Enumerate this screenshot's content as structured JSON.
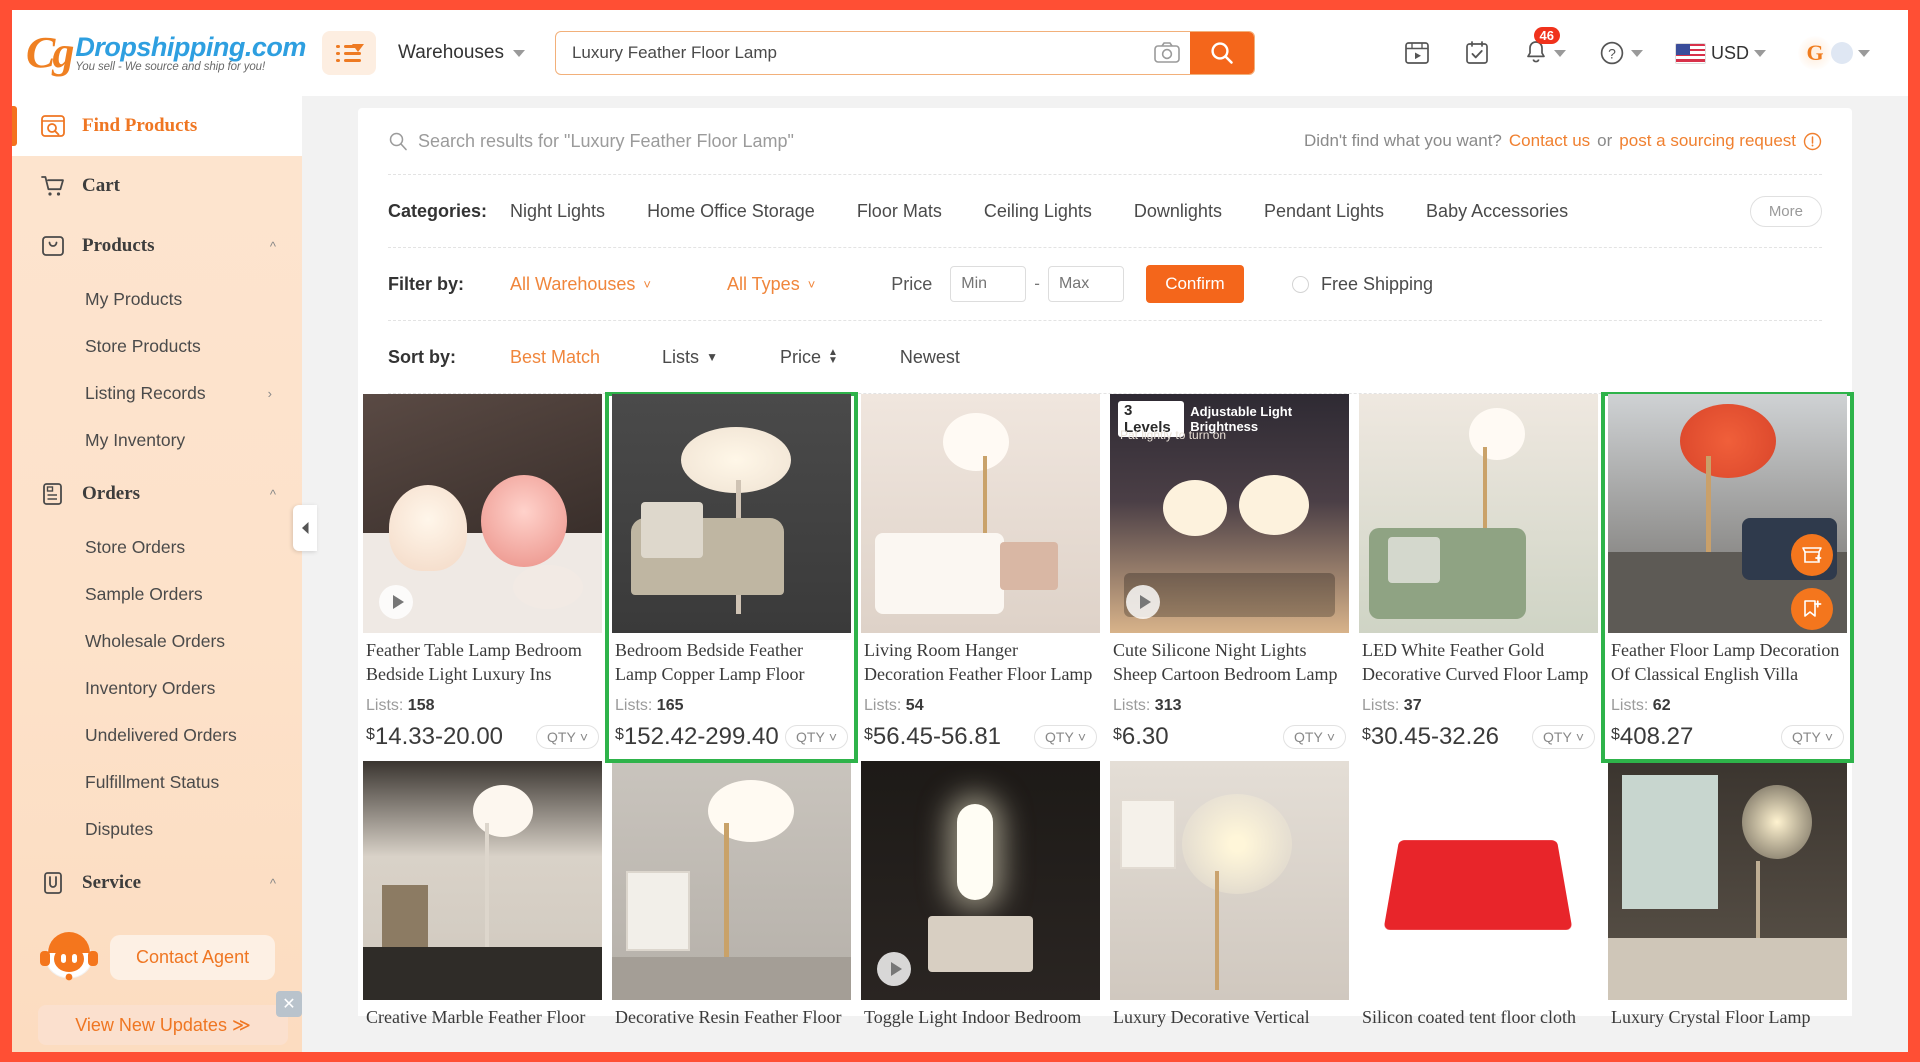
{
  "brand": {
    "name": "Dropshipping.com",
    "tagline": "You sell - We source and ship for you!",
    "logo_mark": "Cg"
  },
  "header": {
    "menu_icon": "list-menu-icon",
    "scope_label": "Warehouses",
    "search_value": "Luxury Feather Floor Lamp",
    "search_placeholder": "Luxury Feather Floor Lamp",
    "camera_icon": "camera-icon",
    "search_icon": "search-icon",
    "icons": [
      {
        "name": "video-tutorial-icon",
        "glyph": "video"
      },
      {
        "name": "tasks-icon",
        "glyph": "checkbox"
      },
      {
        "name": "notifications-bell-icon",
        "glyph": "bell",
        "badge": "46"
      },
      {
        "name": "help-icon",
        "glyph": "question"
      }
    ],
    "currency": "USD",
    "flag": "us-flag-icon",
    "avatar_letter": "G"
  },
  "sidebar": {
    "items": [
      {
        "label": "Find Products",
        "icon": "find-products-icon",
        "active": true,
        "type": "top"
      },
      {
        "label": "Cart",
        "icon": "cart-icon",
        "active": false,
        "type": "top"
      },
      {
        "label": "Products",
        "icon": "products-icon",
        "active": false,
        "type": "top",
        "expanded": true,
        "chevron": "chevron-up-icon"
      },
      {
        "label": "My Products",
        "type": "sub"
      },
      {
        "label": "Store Products",
        "type": "sub"
      },
      {
        "label": "Listing Records",
        "type": "sub",
        "chevron": "chevron-right-icon"
      },
      {
        "label": "My Inventory",
        "type": "sub"
      },
      {
        "label": "Orders",
        "icon": "orders-icon",
        "active": false,
        "type": "top",
        "expanded": true,
        "chevron": "chevron-up-icon"
      },
      {
        "label": "Store Orders",
        "type": "sub"
      },
      {
        "label": "Sample Orders",
        "type": "sub"
      },
      {
        "label": "Wholesale Orders",
        "type": "sub"
      },
      {
        "label": "Inventory Orders",
        "type": "sub"
      },
      {
        "label": "Undelivered Orders",
        "type": "sub"
      },
      {
        "label": "Fulfillment Status",
        "type": "sub"
      },
      {
        "label": "Disputes",
        "type": "sub"
      },
      {
        "label": "Service",
        "icon": "service-icon",
        "active": false,
        "type": "top",
        "expanded": true,
        "chevron": "chevron-up-icon"
      }
    ],
    "contact_agent_label": "Contact Agent",
    "updates_label": "View New Updates ≫",
    "collapse_icon": "collapse-sidebar-icon"
  },
  "results": {
    "heading": "Search results for \"Luxury Feather Floor Lamp\"",
    "not_found_text": "Didn't find what you want?",
    "contact_link": "Contact us",
    "or_text": "or",
    "sourcing_link": "post a sourcing request",
    "info_icon": "info-circle-icon"
  },
  "categories": {
    "label": "Categories:",
    "items": [
      "Night Lights",
      "Home Office Storage",
      "Floor Mats",
      "Ceiling Lights",
      "Downlights",
      "Pendant Lights",
      "Baby Accessories"
    ],
    "more_label": "More"
  },
  "filter": {
    "label": "Filter by:",
    "warehouse_label": "All Warehouses",
    "types_label": "All Types",
    "price_label": "Price",
    "min_placeholder": "Min",
    "max_placeholder": "Max",
    "separator": "-",
    "confirm_label": "Confirm",
    "free_shipping_label": "Free Shipping"
  },
  "sort": {
    "label": "Sort by:",
    "items": [
      {
        "label": "Best Match",
        "active": true
      },
      {
        "label": "Lists",
        "active": false,
        "arrow": "caret-down-icon"
      },
      {
        "label": "Price",
        "active": false,
        "arrow": "sort-updown-icon"
      },
      {
        "label": "Newest",
        "active": false
      }
    ]
  },
  "colors": {
    "accent": "#f4661b",
    "link": "#f08030",
    "highlight": "#2eb34a",
    "sidebar_bg": "#fde4cf",
    "frame": "#ff4f34"
  },
  "products": {
    "lists_label": "Lists:",
    "qty_label": "QTY",
    "row1": [
      {
        "title": "Feather Table Lamp Bedroom Bedside Light Luxury Ins Creati…",
        "lists": "158",
        "price": "14.33-20.00",
        "currency": "$",
        "highlight": false,
        "video": true,
        "img": "a"
      },
      {
        "title": "Bedroom Bedside Feather Lamp Copper Lamp Floor Lamp",
        "lists": "165",
        "price": "152.42-299.40",
        "currency": "$",
        "highlight": true,
        "video": false,
        "img": "b"
      },
      {
        "title": "Living Room Hanger Decoration Feather Floor Lamp",
        "lists": "54",
        "price": "56.45-56.81",
        "currency": "$",
        "highlight": false,
        "video": false,
        "img": "c"
      },
      {
        "title": "Cute Silicone Night Lights Sheep Cartoon Bedroom Lamp For…",
        "lists": "313",
        "price": "6.30",
        "currency": "$",
        "highlight": false,
        "video": true,
        "img": "d",
        "overlay_title": "3 Levels",
        "overlay_sub": "Adjustable Light Brightness",
        "overlay_note": "Pat lightly to turn on"
      },
      {
        "title": "LED White Feather Gold Decorative Curved Floor Lamp",
        "lists": "37",
        "price": "30.45-32.26",
        "currency": "$",
        "highlight": false,
        "video": false,
        "img": "e"
      },
      {
        "title": "Feather Floor Lamp Decoration Of Classical English Villa",
        "lists": "62",
        "price": "408.27",
        "currency": "$",
        "highlight": true,
        "video": false,
        "img": "f",
        "fabs": [
          "add-to-store-icon",
          "add-to-list-icon"
        ]
      }
    ],
    "row2": [
      {
        "title": "Creative Marble Feather Floor",
        "img": "g",
        "video": false
      },
      {
        "title": "Decorative Resin Feather Floor",
        "img": "h",
        "video": false
      },
      {
        "title": "Toggle Light Indoor Bedroom",
        "img": "i",
        "video": true
      },
      {
        "title": "Luxury Decorative Vertical Crystal",
        "img": "j",
        "video": false
      },
      {
        "title": "Silicon coated tent floor cloth",
        "img": "k",
        "video": false
      },
      {
        "title": "Luxury Crystal Floor Lamp Retro",
        "img": "l",
        "video": false
      }
    ]
  }
}
